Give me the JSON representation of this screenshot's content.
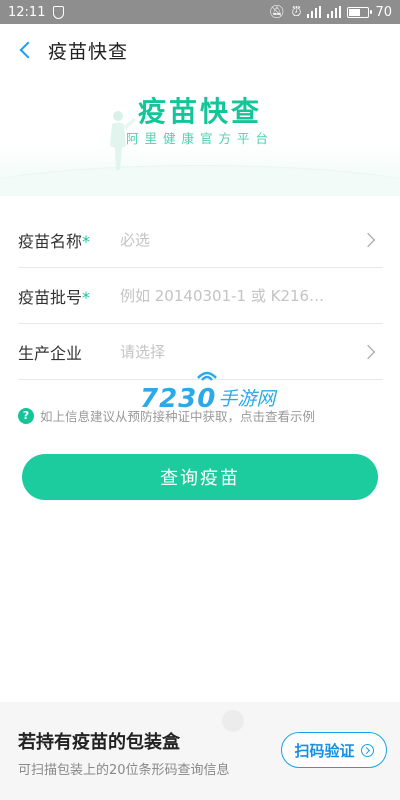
{
  "status_bar": {
    "time": "12:11",
    "battery_level": "70",
    "battery_fraction": 0.7
  },
  "header": {
    "title": "疫苗快查"
  },
  "banner": {
    "title": "疫苗快查",
    "subtitle": "阿里健康官方平台"
  },
  "form": {
    "rows": [
      {
        "label": "疫苗名称",
        "required": true,
        "placeholder": "必选",
        "has_arrow": true
      },
      {
        "label": "疫苗批号",
        "required": true,
        "placeholder": "例如 20140301-1 或 K216…",
        "has_arrow": false
      },
      {
        "label": "生产企业",
        "required": false,
        "placeholder": "请选择",
        "has_arrow": true
      }
    ],
    "required_mark": "*"
  },
  "tip": {
    "icon": "?",
    "text": "如上信息建议从预防接种证中获取，点击查看示例"
  },
  "watermark": {
    "number": "7230",
    "text": "手游网"
  },
  "query_button": {
    "label": "查询疫苗"
  },
  "bottom_card": {
    "title": "若持有疫苗的包装盒",
    "subtitle": "可扫描包装上的20位条形码查询信息",
    "scan_button_label": "扫码验证"
  },
  "colors": {
    "accent_green": "#1dcc9e",
    "accent_blue": "#1aa2e8",
    "status_bar": "#8e8e8e"
  },
  "icons": [
    "back-arrow-icon",
    "chevron-right-icon",
    "help-icon",
    "shield-icon",
    "mute-icon",
    "alarm-icon",
    "signal-icon",
    "battery-icon",
    "scan-chevron-icon"
  ]
}
